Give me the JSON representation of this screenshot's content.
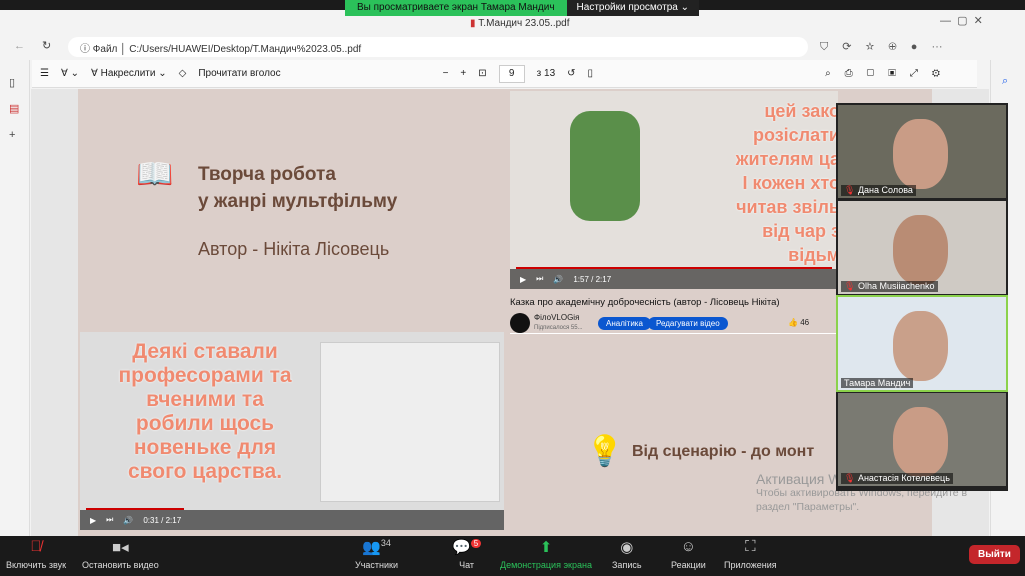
{
  "share_banner": {
    "text": "Вы просматриваете экран Тамара Мандич",
    "settings": "Настройки просмотра"
  },
  "browser": {
    "tab_title": "Т.Мандич 23.05..pdf",
    "address_label": "Файл",
    "address": "C:/Users/HUAWEI/Desktop/Т.Мандич%2023.05..pdf"
  },
  "pdf_toolbar": {
    "draw": "Накреслити",
    "read_aloud": "Прочитати вголос",
    "page": "9",
    "page_total": "з 13"
  },
  "slide": {
    "title_line1": "Творча робота",
    "title_line2": "у жанрі мультфільму",
    "author": "Автор - Нікіта Лісовець",
    "video1": {
      "overlay_lines": [
        "цей зако",
        "розіслати",
        "жителям ца",
        "І кожен хто",
        "читав звіль",
        "від чар з",
        "відьм"
      ],
      "time": "1:57 / 2:17",
      "title": "Казка про академічну доброчесність (автор - Лісовець Нікіта)",
      "channel": "ФілоVLOGія",
      "subs": "Підписалося 55...",
      "btn_analytics": "Аналітика",
      "btn_edit": "Редагувати відео",
      "likes": "46"
    },
    "video2": {
      "overlay_lines": [
        "Деякі ставали",
        "професорами та",
        "вченими та",
        "робили щось",
        "новеньке для",
        "свого царства."
      ],
      "time": "0:31 / 2:17"
    },
    "section2": "Від сценарію - до монт"
  },
  "watermark": {
    "title": "Активация Windows",
    "line1": "Чтобы активировать Windows, перейдите в",
    "line2": "раздел \"Параметры\"."
  },
  "participants": [
    {
      "name": "Дана Солова"
    },
    {
      "name": "Olha Musiiachenko"
    },
    {
      "name": "Тамара Мандич"
    },
    {
      "name": "Анастасія Котелевець"
    }
  ],
  "zoom_bar": {
    "unmute": "Включить звук",
    "video": "Остановить видео",
    "participants": "Участники",
    "participants_count": "34",
    "chat": "Чат",
    "chat_badge": "5",
    "share": "Демонстрация экрана",
    "record": "Запись",
    "reactions": "Реакции",
    "apps": "Приложения",
    "leave": "Выйти"
  },
  "colors": {
    "accent_green": "#2bc15a",
    "leave_red": "#c4262b",
    "slide_bg": "#dccfca",
    "title_brown": "#6b4a3a"
  }
}
